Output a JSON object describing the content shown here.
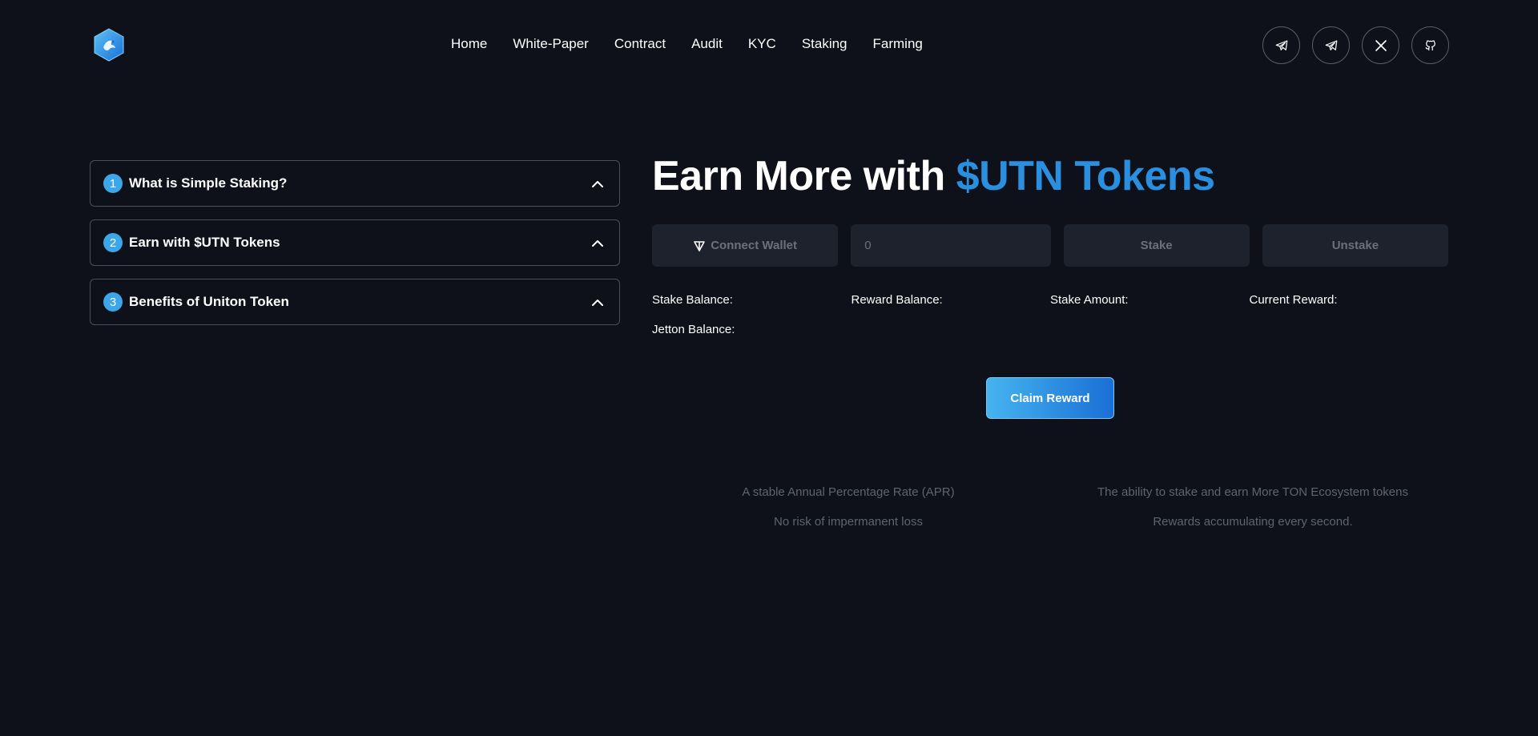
{
  "nav": {
    "items": [
      "Home",
      "White-Paper",
      "Contract",
      "Audit",
      "KYC",
      "Staking",
      "Farming"
    ]
  },
  "socials": [
    "telegram-icon",
    "telegram-icon",
    "x-icon",
    "github-icon"
  ],
  "accordion": [
    {
      "num": "1",
      "title": "What is Simple Staking?"
    },
    {
      "num": "2",
      "title": "Earn with $UTN Tokens"
    },
    {
      "num": "3",
      "title": "Benefits of Uniton Token"
    }
  ],
  "headline": {
    "prefix": "Earn More with ",
    "accent": "$UTN Tokens"
  },
  "controls": {
    "connect_label": "Connect Wallet",
    "amount_placeholder": "0",
    "stake_label": "Stake",
    "unstake_label": "Unstake"
  },
  "stats": {
    "stake_balance": "Stake Balance:",
    "reward_balance": "Reward Balance:",
    "stake_amount": "Stake Amount:",
    "current_reward": "Current Reward:",
    "jetton_balance": "Jetton Balance:"
  },
  "claim_label": "Claim Reward",
  "benefits": {
    "left": [
      "A stable Annual Percentage Rate (APR)",
      "No risk of impermanent loss"
    ],
    "right": [
      "The ability to stake and earn More TON Ecosystem tokens",
      "Rewards accumulating every second."
    ]
  },
  "colors": {
    "background": "#0e1119",
    "accent": "#2b8fe0",
    "badge": "#3ba7e8",
    "control_bg": "#1e222c"
  }
}
